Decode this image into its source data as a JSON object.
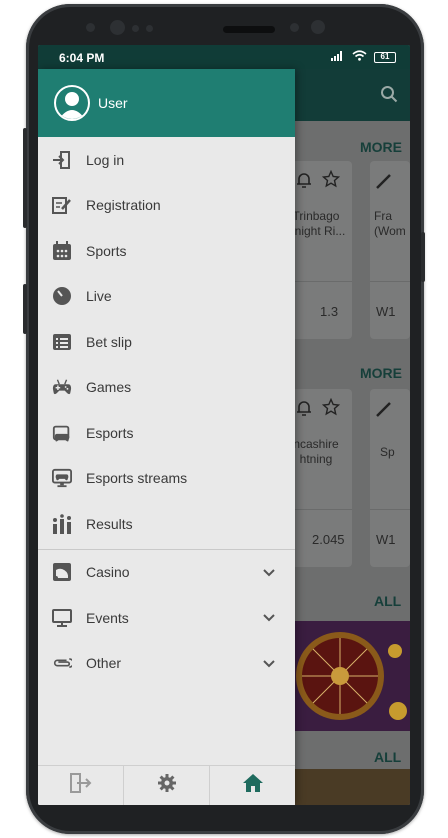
{
  "status_bar": {
    "time": "6:04 PM",
    "battery": "61"
  },
  "drawer": {
    "user_label": "User",
    "items": [
      {
        "label": "Log in",
        "icon": "login-icon"
      },
      {
        "label": "Registration",
        "icon": "registration-icon"
      },
      {
        "label": "Sports",
        "icon": "sports-icon"
      },
      {
        "label": "Live",
        "icon": "live-icon"
      },
      {
        "label": "Bet slip",
        "icon": "bet-slip-icon"
      },
      {
        "label": "Games",
        "icon": "games-icon"
      },
      {
        "label": "Esports",
        "icon": "esports-icon"
      },
      {
        "label": "Esports streams",
        "icon": "esports-streams-icon"
      },
      {
        "label": "Results",
        "icon": "results-icon"
      }
    ],
    "expandable_items": [
      {
        "label": "Casino",
        "icon": "casino-icon"
      },
      {
        "label": "Events",
        "icon": "events-icon"
      },
      {
        "label": "Other",
        "icon": "other-icon"
      }
    ],
    "bottom_tabs": [
      "logout-icon",
      "settings-icon",
      "home-icon"
    ]
  },
  "background": {
    "more_1": "MORE",
    "more_2": "MORE",
    "all_1": "ALL",
    "all_2": "ALL",
    "card1_team": "Trinbago\nKnight Ri...",
    "card1_value": "1.3",
    "card2_team": "Fra\n(Wom",
    "card2_value": "W1",
    "card3_team": "ncashire\nhtning",
    "card3_value": "2.045",
    "card4_team": "Sp",
    "card4_value": "W1"
  },
  "colors": {
    "accent": "#1f7e72",
    "status_bar": "#103c37",
    "drawer_bg": "#e9e9e9",
    "home_active": "#1f6b5e"
  }
}
